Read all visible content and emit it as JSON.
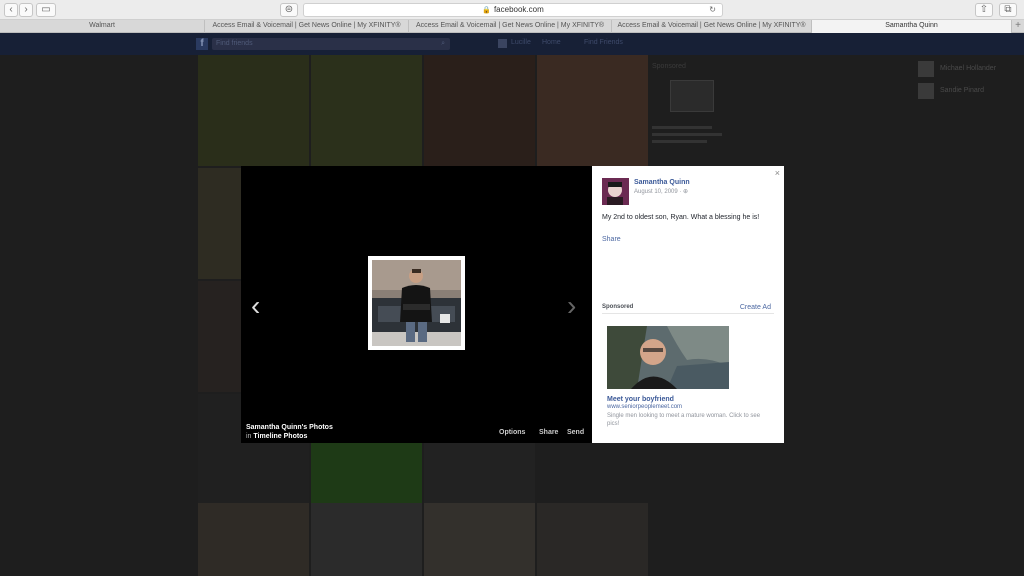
{
  "browser": {
    "url": "facebook.com",
    "tabs": [
      {
        "label": "Walmart"
      },
      {
        "label": "Access Email & Voicemail | Get News Online | My XFINITY®"
      },
      {
        "label": "Access Email & Voicemail | Get News Online | My XFINITY®"
      },
      {
        "label": "Access Email & Voicemail | Get News Online | My XFINITY®"
      },
      {
        "label": "Samantha Quinn"
      }
    ],
    "new_tab_label": "+"
  },
  "facebook": {
    "search_placeholder": "Find friends",
    "nav": {
      "profile": "Lucille",
      "home": "Home",
      "find_friends": "Find Friends"
    },
    "sponsored_label": "Sponsored",
    "friends": [
      {
        "name": "Michael Hollander"
      },
      {
        "name": "Sandie Pinard"
      }
    ]
  },
  "viewer": {
    "prev_icon": "‹",
    "next_icon": "›",
    "owner": "Samantha Quinn's Photos",
    "album_prefix": "in",
    "album": "Timeline Photos",
    "options": "Options",
    "share": "Share",
    "send": "Send"
  },
  "panel": {
    "close": "×",
    "name": "Samantha Quinn",
    "date": "August 10, 2009 · ⊕",
    "caption": "My 2nd to oldest son, Ryan. What a blessing he is!",
    "share": "Share",
    "sponsored": "Sponsored",
    "create_ad": "Create Ad",
    "ad": {
      "title": "Meet your boyfriend",
      "url": "www.seniorpeoplemeet.com",
      "description": "Single men looking to meet a mature woman. Click to see pics!"
    }
  },
  "colors": {
    "fb_blue": "#3b5998",
    "link_blue": "#4b67a1",
    "viewer_bg": "#000000"
  }
}
